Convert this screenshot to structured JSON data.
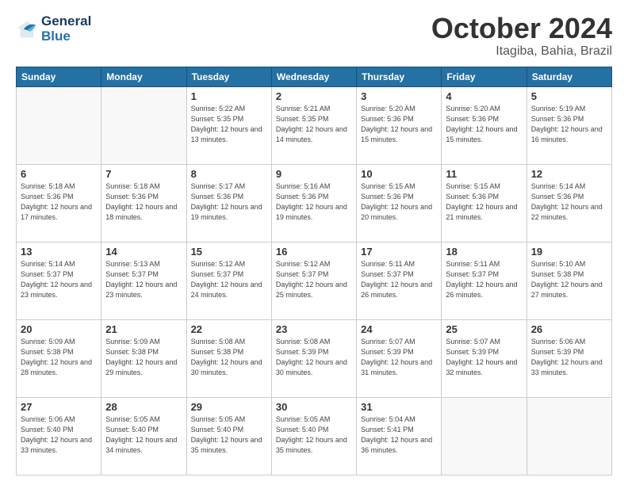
{
  "header": {
    "logo_line1": "General",
    "logo_line2": "Blue",
    "title": "October 2024",
    "subtitle": "Itagiba, Bahia, Brazil"
  },
  "days_of_week": [
    "Sunday",
    "Monday",
    "Tuesday",
    "Wednesday",
    "Thursday",
    "Friday",
    "Saturday"
  ],
  "weeks": [
    [
      {
        "day": "",
        "empty": true
      },
      {
        "day": "",
        "empty": true
      },
      {
        "day": "1",
        "sunrise": "Sunrise: 5:22 AM",
        "sunset": "Sunset: 5:35 PM",
        "daylight": "Daylight: 12 hours and 13 minutes."
      },
      {
        "day": "2",
        "sunrise": "Sunrise: 5:21 AM",
        "sunset": "Sunset: 5:35 PM",
        "daylight": "Daylight: 12 hours and 14 minutes."
      },
      {
        "day": "3",
        "sunrise": "Sunrise: 5:20 AM",
        "sunset": "Sunset: 5:36 PM",
        "daylight": "Daylight: 12 hours and 15 minutes."
      },
      {
        "day": "4",
        "sunrise": "Sunrise: 5:20 AM",
        "sunset": "Sunset: 5:36 PM",
        "daylight": "Daylight: 12 hours and 15 minutes."
      },
      {
        "day": "5",
        "sunrise": "Sunrise: 5:19 AM",
        "sunset": "Sunset: 5:36 PM",
        "daylight": "Daylight: 12 hours and 16 minutes."
      }
    ],
    [
      {
        "day": "6",
        "sunrise": "Sunrise: 5:18 AM",
        "sunset": "Sunset: 5:36 PM",
        "daylight": "Daylight: 12 hours and 17 minutes."
      },
      {
        "day": "7",
        "sunrise": "Sunrise: 5:18 AM",
        "sunset": "Sunset: 5:36 PM",
        "daylight": "Daylight: 12 hours and 18 minutes."
      },
      {
        "day": "8",
        "sunrise": "Sunrise: 5:17 AM",
        "sunset": "Sunset: 5:36 PM",
        "daylight": "Daylight: 12 hours and 19 minutes."
      },
      {
        "day": "9",
        "sunrise": "Sunrise: 5:16 AM",
        "sunset": "Sunset: 5:36 PM",
        "daylight": "Daylight: 12 hours and 19 minutes."
      },
      {
        "day": "10",
        "sunrise": "Sunrise: 5:15 AM",
        "sunset": "Sunset: 5:36 PM",
        "daylight": "Daylight: 12 hours and 20 minutes."
      },
      {
        "day": "11",
        "sunrise": "Sunrise: 5:15 AM",
        "sunset": "Sunset: 5:36 PM",
        "daylight": "Daylight: 12 hours and 21 minutes."
      },
      {
        "day": "12",
        "sunrise": "Sunrise: 5:14 AM",
        "sunset": "Sunset: 5:36 PM",
        "daylight": "Daylight: 12 hours and 22 minutes."
      }
    ],
    [
      {
        "day": "13",
        "sunrise": "Sunrise: 5:14 AM",
        "sunset": "Sunset: 5:37 PM",
        "daylight": "Daylight: 12 hours and 23 minutes."
      },
      {
        "day": "14",
        "sunrise": "Sunrise: 5:13 AM",
        "sunset": "Sunset: 5:37 PM",
        "daylight": "Daylight: 12 hours and 23 minutes."
      },
      {
        "day": "15",
        "sunrise": "Sunrise: 5:12 AM",
        "sunset": "Sunset: 5:37 PM",
        "daylight": "Daylight: 12 hours and 24 minutes."
      },
      {
        "day": "16",
        "sunrise": "Sunrise: 5:12 AM",
        "sunset": "Sunset: 5:37 PM",
        "daylight": "Daylight: 12 hours and 25 minutes."
      },
      {
        "day": "17",
        "sunrise": "Sunrise: 5:11 AM",
        "sunset": "Sunset: 5:37 PM",
        "daylight": "Daylight: 12 hours and 26 minutes."
      },
      {
        "day": "18",
        "sunrise": "Sunrise: 5:11 AM",
        "sunset": "Sunset: 5:37 PM",
        "daylight": "Daylight: 12 hours and 26 minutes."
      },
      {
        "day": "19",
        "sunrise": "Sunrise: 5:10 AM",
        "sunset": "Sunset: 5:38 PM",
        "daylight": "Daylight: 12 hours and 27 minutes."
      }
    ],
    [
      {
        "day": "20",
        "sunrise": "Sunrise: 5:09 AM",
        "sunset": "Sunset: 5:38 PM",
        "daylight": "Daylight: 12 hours and 28 minutes."
      },
      {
        "day": "21",
        "sunrise": "Sunrise: 5:09 AM",
        "sunset": "Sunset: 5:38 PM",
        "daylight": "Daylight: 12 hours and 29 minutes."
      },
      {
        "day": "22",
        "sunrise": "Sunrise: 5:08 AM",
        "sunset": "Sunset: 5:38 PM",
        "daylight": "Daylight: 12 hours and 30 minutes."
      },
      {
        "day": "23",
        "sunrise": "Sunrise: 5:08 AM",
        "sunset": "Sunset: 5:39 PM",
        "daylight": "Daylight: 12 hours and 30 minutes."
      },
      {
        "day": "24",
        "sunrise": "Sunrise: 5:07 AM",
        "sunset": "Sunset: 5:39 PM",
        "daylight": "Daylight: 12 hours and 31 minutes."
      },
      {
        "day": "25",
        "sunrise": "Sunrise: 5:07 AM",
        "sunset": "Sunset: 5:39 PM",
        "daylight": "Daylight: 12 hours and 32 minutes."
      },
      {
        "day": "26",
        "sunrise": "Sunrise: 5:06 AM",
        "sunset": "Sunset: 5:39 PM",
        "daylight": "Daylight: 12 hours and 33 minutes."
      }
    ],
    [
      {
        "day": "27",
        "sunrise": "Sunrise: 5:06 AM",
        "sunset": "Sunset: 5:40 PM",
        "daylight": "Daylight: 12 hours and 33 minutes."
      },
      {
        "day": "28",
        "sunrise": "Sunrise: 5:05 AM",
        "sunset": "Sunset: 5:40 PM",
        "daylight": "Daylight: 12 hours and 34 minutes."
      },
      {
        "day": "29",
        "sunrise": "Sunrise: 5:05 AM",
        "sunset": "Sunset: 5:40 PM",
        "daylight": "Daylight: 12 hours and 35 minutes."
      },
      {
        "day": "30",
        "sunrise": "Sunrise: 5:05 AM",
        "sunset": "Sunset: 5:40 PM",
        "daylight": "Daylight: 12 hours and 35 minutes."
      },
      {
        "day": "31",
        "sunrise": "Sunrise: 5:04 AM",
        "sunset": "Sunset: 5:41 PM",
        "daylight": "Daylight: 12 hours and 36 minutes."
      },
      {
        "day": "",
        "empty": true
      },
      {
        "day": "",
        "empty": true
      }
    ]
  ]
}
